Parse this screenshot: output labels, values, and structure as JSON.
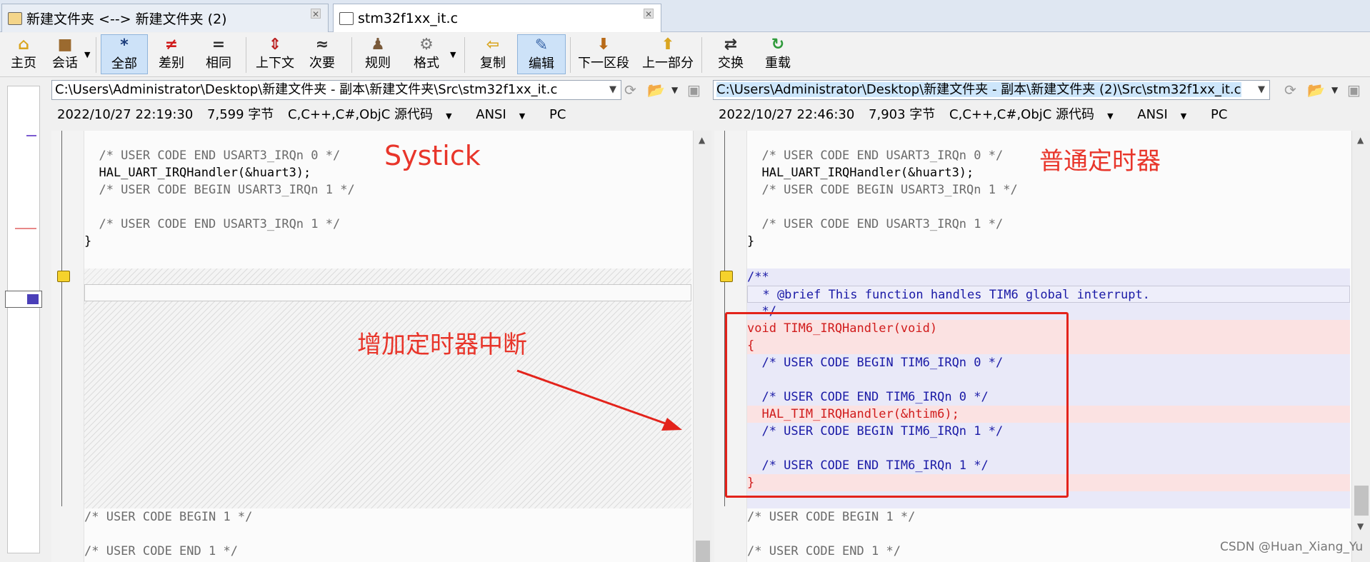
{
  "tabs": [
    {
      "label": "新建文件夹 <--> 新建文件夹 (2)",
      "active": false
    },
    {
      "label": "stm32f1xx_it.c",
      "active": true
    }
  ],
  "toolbar": {
    "home": "主页",
    "session": "会话",
    "all": "全部",
    "diffs": "差别",
    "same": "相同",
    "context": "上下文",
    "minor": "次要",
    "rules": "规则",
    "format": "格式",
    "copy": "复制",
    "edit": "编辑",
    "next_section": "下一区段",
    "prev_section": "上一部分",
    "swap": "交换",
    "reload": "重载",
    "icons": {
      "all": "*",
      "diffs": "≠",
      "same": "=",
      "minor": "≈"
    }
  },
  "left": {
    "path": "C:\\Users\\Administrator\\Desktop\\新建文件夹 - 副本\\新建文件夹\\Src\\stm32f1xx_it.c",
    "info": {
      "datetime": "2022/10/27 22:19:30",
      "size": "7,599 字节",
      "language": "C,C++,C#,ObjC 源代码",
      "encoding": "ANSI",
      "line_end": "PC"
    },
    "code_top": [
      "  /* USER CODE END USART3_IRQn 0 */",
      "  HAL_UART_IRQHandler(&huart3);",
      "  /* USER CODE BEGIN USART3_IRQn 1 */",
      "",
      "  /* USER CODE END USART3_IRQn 1 */",
      "}"
    ],
    "code_bottom": [
      "/* USER CODE BEGIN 1 */",
      "",
      "/* USER CODE END 1 */"
    ]
  },
  "right": {
    "path": "C:\\Users\\Administrator\\Desktop\\新建文件夹 - 副本\\新建文件夹 (2)\\Src\\stm32f1xx_it.c",
    "info": {
      "datetime": "2022/10/27 22:46:30",
      "size": "7,903 字节",
      "language": "C,C++,C#,ObjC 源代码",
      "encoding": "ANSI",
      "line_end": "PC"
    },
    "code_top": [
      "  /* USER CODE END USART3_IRQn 0 */",
      "  HAL_UART_IRQHandler(&huart3);",
      "  /* USER CODE BEGIN USART3_IRQn 1 */",
      "",
      "  /* USER CODE END USART3_IRQn 1 */",
      "}"
    ],
    "code_diff": [
      "/**",
      "  * @brief This function handles TIM6 global interrupt.",
      "  */",
      "void TIM6_IRQHandler(void)",
      "{",
      "  /* USER CODE BEGIN TIM6_IRQn 0 */",
      "",
      "  /* USER CODE END TIM6_IRQn 0 */",
      "  HAL_TIM_IRQHandler(&htim6);",
      "  /* USER CODE BEGIN TIM6_IRQn 1 */",
      "",
      "  /* USER CODE END TIM6_IRQn 1 */",
      "}"
    ],
    "code_bottom": [
      "/* USER CODE BEGIN 1 */",
      "",
      "/* USER CODE END 1 */"
    ]
  },
  "annotations": {
    "left_title": "Systick",
    "right_title": "普通定时器",
    "middle": "增加定时器中断",
    "color": "#e8352a"
  },
  "watermark": "CSDN @Huan_Xiang_Yu"
}
